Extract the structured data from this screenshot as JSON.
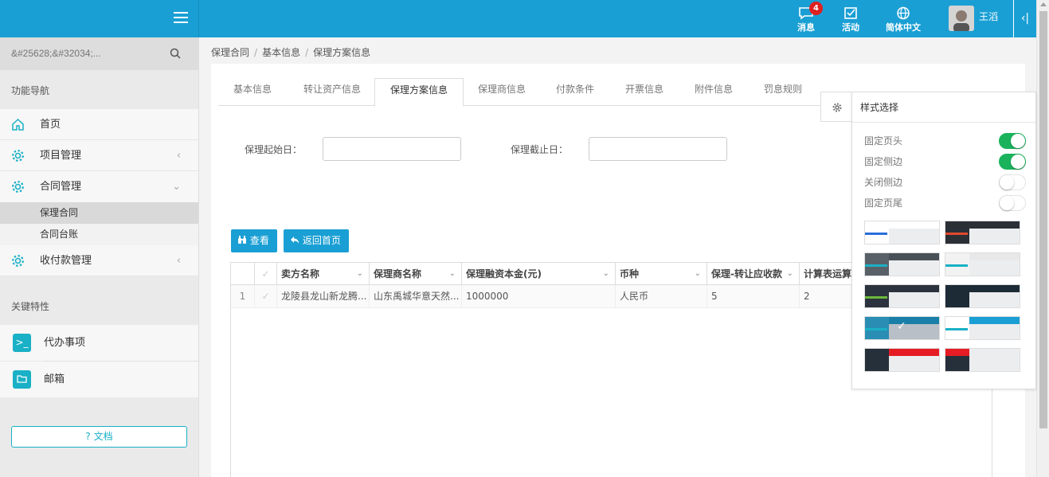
{
  "topbar": {
    "messages_label": "消息",
    "messages_badge": "4",
    "activity_label": "活动",
    "language_label": "简体中文",
    "username": "王滔",
    "collapse_glyph": "‹|"
  },
  "sidebar": {
    "search_placeholder": "&#25628;&#32034;...",
    "nav_heading": "功能导航",
    "items": [
      {
        "label": "首页",
        "icon": "home-icon"
      },
      {
        "label": "项目管理",
        "icon": "gear-icon"
      },
      {
        "label": "合同管理",
        "icon": "gear-icon"
      },
      {
        "label": "收付款管理",
        "icon": "gear-icon"
      }
    ],
    "sub_items": [
      "保理合同",
      "合同台账"
    ],
    "key_heading": "关键特性",
    "key_items": [
      {
        "label": "代办事项",
        "icon": "terminal-icon"
      },
      {
        "label": "邮箱",
        "icon": "folder-icon"
      }
    ],
    "doc_button": "? 文档"
  },
  "breadcrumb": [
    "保理合同",
    "基本信息",
    "保理方案信息"
  ],
  "tabs": [
    "基本信息",
    "转让资产信息",
    "保理方案信息",
    "保理商信息",
    "付款条件",
    "开票信息",
    "附件信息",
    "罚息规则"
  ],
  "form": {
    "start_label": "保理起始日：",
    "start_value": "",
    "end_label": "保理截止日：",
    "end_value": ""
  },
  "buttons": {
    "view": "查看",
    "back": "返回首页"
  },
  "grid": {
    "columns": [
      "卖方名称",
      "保理商名称",
      "保理融资本金(元)",
      "币种",
      "保理-转让应收款",
      "计算表运算规"
    ],
    "rows": [
      {
        "index": "1",
        "seller": "龙陵县龙山新龙腾...",
        "factor": "山东禹城华意天然...",
        "principal": "1000000",
        "currency": "人民币",
        "receivable": "5",
        "rule": "2"
      }
    ]
  },
  "style_panel": {
    "title": "样式选择",
    "options": [
      {
        "label": "固定页头",
        "on": true
      },
      {
        "label": "固定侧边",
        "on": true
      },
      {
        "label": "关闭侧边",
        "on": false
      },
      {
        "label": "固定页尾",
        "on": false
      }
    ],
    "colors": {
      "primary": "#1a9fd4",
      "switch_on": "#1ab35c",
      "accent_teal": "#1ab0c6"
    }
  }
}
